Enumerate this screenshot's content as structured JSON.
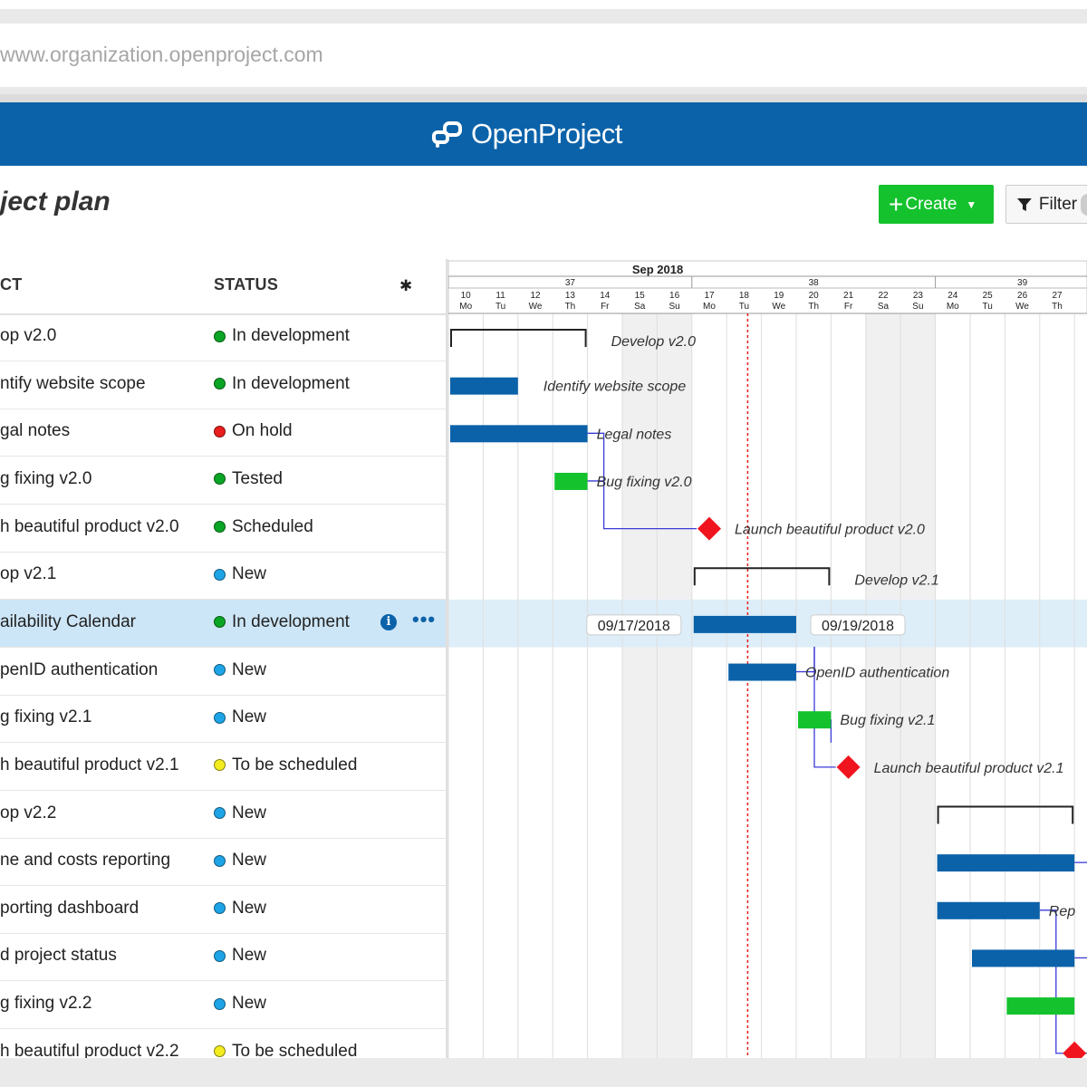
{
  "browser": {
    "url": "www.organization.openproject.com"
  },
  "app": {
    "name": "OpenProject"
  },
  "page": {
    "title": "ject plan"
  },
  "toolbar": {
    "create_label": "Create",
    "filter_label": "Filter"
  },
  "table": {
    "columns": [
      "CT",
      "STATUS"
    ],
    "rows": [
      {
        "subject": "op v2.0",
        "status": "In development",
        "color": "#0aa524"
      },
      {
        "subject": "ntify website scope",
        "status": "In development",
        "color": "#0aa524"
      },
      {
        "subject": "gal notes",
        "status": "On hold",
        "color": "#e81d1d"
      },
      {
        "subject": "g fixing v2.0",
        "status": "Tested",
        "color": "#0aa524"
      },
      {
        "subject": "h beautiful product v2.0",
        "status": "Scheduled",
        "color": "#0aa524"
      },
      {
        "subject": "op v2.1",
        "status": "New",
        "color": "#1ea4e6"
      },
      {
        "subject": "ailability Calendar",
        "status": "In development",
        "color": "#0aa524",
        "selected": true
      },
      {
        "subject": "penID authentication",
        "status": "New",
        "color": "#1ea4e6"
      },
      {
        "subject": "g fixing v2.1",
        "status": "New",
        "color": "#1ea4e6"
      },
      {
        "subject": "h beautiful product v2.1",
        "status": "To be scheduled",
        "color": "#f2ec20"
      },
      {
        "subject": "op v2.2",
        "status": "New",
        "color": "#1ea4e6"
      },
      {
        "subject": "ne and costs reporting",
        "status": "New",
        "color": "#1ea4e6"
      },
      {
        "subject": "porting dashboard",
        "status": "New",
        "color": "#1ea4e6"
      },
      {
        "subject": "d project status",
        "status": "New",
        "color": "#1ea4e6"
      },
      {
        "subject": "g fixing v2.2",
        "status": "New",
        "color": "#1ea4e6"
      },
      {
        "subject": "h beautiful product v2.2",
        "status": "To be scheduled",
        "color": "#f2ec20"
      }
    ]
  },
  "gantt": {
    "month": "Sep 2018",
    "weeks": [
      {
        "label": "37",
        "from": 0,
        "to": 6
      },
      {
        "label": "38",
        "from": 7,
        "to": 13
      },
      {
        "label": "39",
        "from": 14,
        "to": 18
      }
    ],
    "days": [
      {
        "num": "10",
        "dow": "Mo"
      },
      {
        "num": "11",
        "dow": "Tu"
      },
      {
        "num": "12",
        "dow": "We"
      },
      {
        "num": "13",
        "dow": "Th"
      },
      {
        "num": "14",
        "dow": "Fr"
      },
      {
        "num": "15",
        "dow": "Sa",
        "weekend": true
      },
      {
        "num": "16",
        "dow": "Su",
        "weekend": true
      },
      {
        "num": "17",
        "dow": "Mo"
      },
      {
        "num": "18",
        "dow": "Tu"
      },
      {
        "num": "19",
        "dow": "We"
      },
      {
        "num": "20",
        "dow": "Th"
      },
      {
        "num": "21",
        "dow": "Fr"
      },
      {
        "num": "22",
        "dow": "Sa",
        "weekend": true
      },
      {
        "num": "23",
        "dow": "Su",
        "weekend": true
      },
      {
        "num": "24",
        "dow": "Mo"
      },
      {
        "num": "25",
        "dow": "Tu"
      },
      {
        "num": "26",
        "dow": "We"
      },
      {
        "num": "27",
        "dow": "Th"
      },
      {
        "num": "",
        "dow": ""
      }
    ],
    "today_index": 8,
    "selected_dates": {
      "start": "09/17/2018",
      "end": "09/19/2018"
    },
    "items": [
      {
        "type": "bracket",
        "start": 0,
        "end": 4,
        "label": "Develop v2.0"
      },
      {
        "type": "bar",
        "start": 0,
        "end": 2,
        "color": "#0b62a9",
        "label": "Identify website scope"
      },
      {
        "type": "bar",
        "start": 0,
        "end": 4,
        "color": "#0b62a9",
        "label": "Legal notes"
      },
      {
        "type": "bar",
        "start": 3,
        "end": 4,
        "color": "#14c22e",
        "label": "Bug fixing v2.0"
      },
      {
        "type": "milestone",
        "at": 7.5,
        "label": "Launch beautiful product v2.0"
      },
      {
        "type": "bracket",
        "start": 7,
        "end": 11,
        "label": "Develop v2.1"
      },
      {
        "type": "bar",
        "start": 7,
        "end": 10,
        "color": "#0b62a9",
        "label": ""
      },
      {
        "type": "bar",
        "start": 8,
        "end": 10,
        "color": "#0b62a9",
        "label": "OpenID authentication"
      },
      {
        "type": "bar",
        "start": 10,
        "end": 11,
        "color": "#14c22e",
        "label": "Bug fixing v2.1"
      },
      {
        "type": "milestone",
        "at": 11.5,
        "label": "Launch beautiful product v2.1"
      },
      {
        "type": "bracket",
        "start": 14,
        "end": 18,
        "label": ""
      },
      {
        "type": "bar",
        "start": 14,
        "end": 18,
        "color": "#0b62a9",
        "label": ""
      },
      {
        "type": "bar",
        "start": 14,
        "end": 17,
        "color": "#0b62a9",
        "label": "Rep"
      },
      {
        "type": "bar",
        "start": 15,
        "end": 18,
        "color": "#0b62a9",
        "label": ""
      },
      {
        "type": "bar",
        "start": 16,
        "end": 18,
        "color": "#14c22e",
        "label": ""
      },
      {
        "type": "milestone",
        "at": 18,
        "label": ""
      }
    ]
  }
}
